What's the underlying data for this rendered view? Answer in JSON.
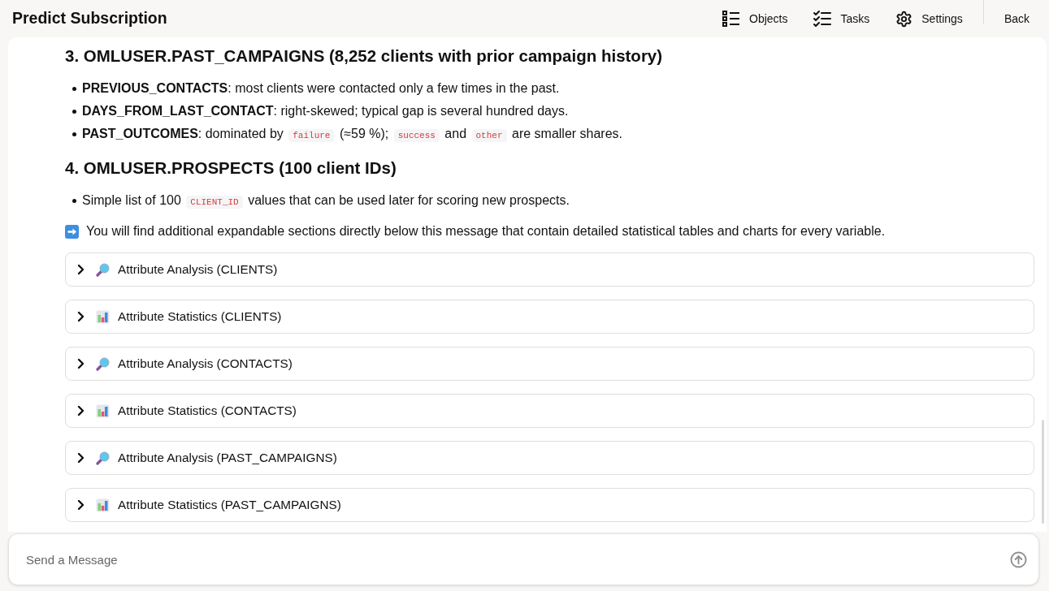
{
  "header": {
    "title": "Predict Subscription",
    "nav": [
      {
        "kind": "objects",
        "label": "Objects"
      },
      {
        "kind": "tasks",
        "label": "Tasks"
      },
      {
        "kind": "settings",
        "label": "Settings"
      }
    ],
    "back": "Back"
  },
  "message": {
    "blocks": [
      {
        "kind": "heading",
        "text": "3. OMLUSER.PAST_CAMPAIGNS (8,252 clients with prior campaign history)"
      },
      {
        "kind": "list",
        "items": [
          {
            "parts": [
              {
                "kind": "bold",
                "text": "PREVIOUS_CONTACTS"
              },
              {
                "kind": "text",
                "text": ": most clients were contacted only a few times in the past."
              }
            ]
          },
          {
            "parts": [
              {
                "kind": "bold",
                "text": "DAYS_FROM_LAST_CONTACT"
              },
              {
                "kind": "text",
                "text": ": right-skewed; typical gap is several hundred days."
              }
            ]
          },
          {
            "parts": [
              {
                "kind": "bold",
                "text": "PAST_OUTCOMES"
              },
              {
                "kind": "text",
                "text": ": dominated by "
              },
              {
                "kind": "code",
                "text": "failure"
              },
              {
                "kind": "text",
                "text": " (≈59 %); "
              },
              {
                "kind": "code",
                "text": "success"
              },
              {
                "kind": "text",
                "text": " and "
              },
              {
                "kind": "code",
                "text": "other"
              },
              {
                "kind": "text",
                "text": " are smaller shares."
              }
            ]
          }
        ]
      },
      {
        "kind": "heading",
        "text": "4. OMLUSER.PROSPECTS (100 client IDs)"
      },
      {
        "kind": "list",
        "items": [
          {
            "parts": [
              {
                "kind": "text",
                "text": "Simple list of 100 "
              },
              {
                "kind": "code",
                "text": "CLIENT_ID"
              },
              {
                "kind": "text",
                "text": " values that can be used later for scoring new prospects."
              }
            ]
          }
        ]
      },
      {
        "kind": "note",
        "text": "You will find additional expandable sections directly below this message that contain detailed statistical tables and charts for every variable."
      }
    ],
    "sections": [
      {
        "kind": "analysis",
        "label": "Attribute Analysis (CLIENTS)",
        "expanded": false
      },
      {
        "kind": "statistics",
        "label": "Attribute Statistics (CLIENTS)",
        "expanded": false
      },
      {
        "kind": "analysis",
        "label": "Attribute Analysis (CONTACTS)",
        "expanded": false
      },
      {
        "kind": "statistics",
        "label": "Attribute Statistics (CONTACTS)",
        "expanded": false
      },
      {
        "kind": "analysis",
        "label": "Attribute Analysis (PAST_CAMPAIGNS)",
        "expanded": false
      },
      {
        "kind": "statistics",
        "label": "Attribute Statistics (PAST_CAMPAIGNS)",
        "expanded": false
      }
    ]
  },
  "composer": {
    "placeholder": "Send a Message"
  }
}
